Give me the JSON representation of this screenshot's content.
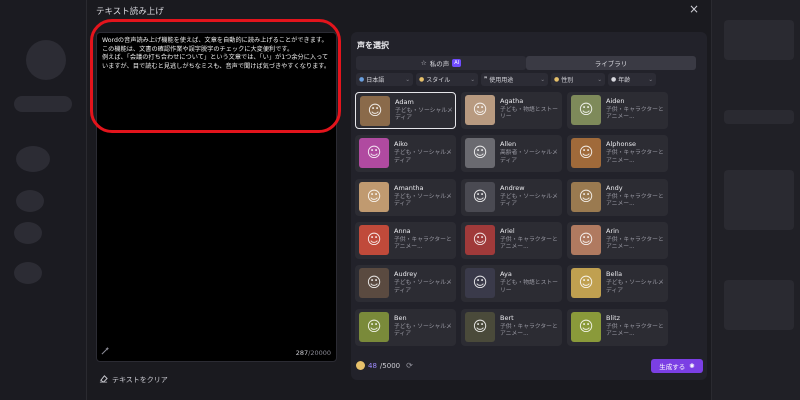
{
  "modal": {
    "title": "テキスト読み上げ",
    "close_icon": "×"
  },
  "editor": {
    "text": "Wordの音声読み上げ機能を使えば、文章を自動的に読み上げることができます。\nこの機能は、文書の確認作業や誤字脱字のチェックに大変便利です。\n例えば、「会議の打ち合わせについて」という文章では、「い」が1つ余分に入っていますが、目で読むと見逃しがちなミスも、音声で聞けば気づきやすくなります。",
    "count_current": "287",
    "count_max": "/20000",
    "clear_label": "テキストをクリア"
  },
  "voice_panel": {
    "title": "声を選択",
    "tabs": [
      {
        "label": "私の声",
        "badge": "AI"
      },
      {
        "label": "ライブラリ"
      }
    ],
    "filters": [
      {
        "icon": "globe-icon",
        "label": "日本語"
      },
      {
        "icon": "smile-icon",
        "label": "スタイル"
      },
      {
        "icon": "quote-icon",
        "label": "使用用途"
      },
      {
        "icon": "person-icon",
        "label": "性別"
      },
      {
        "icon": "age-icon",
        "label": "年齢"
      }
    ],
    "voices": [
      {
        "name": "Adam",
        "desc": "子ども・ソーシャルメディア",
        "color": "#8a6a4a",
        "selected": true
      },
      {
        "name": "Agatha",
        "desc": "子ども・物語とストーリー",
        "color": "#b89a80"
      },
      {
        "name": "Aiden",
        "desc": "子供・キャラクターとアニメー...",
        "color": "#7e8a5a"
      },
      {
        "name": "Aiko",
        "desc": "子ども・ソーシャルメディア",
        "color": "#b04aa0"
      },
      {
        "name": "Allen",
        "desc": "高齢者・ソーシャルメディア",
        "color": "#6a6a70"
      },
      {
        "name": "Alphonse",
        "desc": "子供・キャラクターとアニメー...",
        "color": "#a06a3a"
      },
      {
        "name": "Amantha",
        "desc": "子ども・ソーシャルメディア",
        "color": "#c09a70"
      },
      {
        "name": "Andrew",
        "desc": "子ども・ソーシャルメディア",
        "color": "#4a4a52"
      },
      {
        "name": "Andy",
        "desc": "子供・キャラクターとアニメー...",
        "color": "#9a7a50"
      },
      {
        "name": "Anna",
        "desc": "子供・キャラクターとアニメー...",
        "color": "#c04a3a"
      },
      {
        "name": "Ariel",
        "desc": "子供・キャラクターとアニメー...",
        "color": "#a03a3a"
      },
      {
        "name": "Arin",
        "desc": "子供・キャラクターとアニメー...",
        "color": "#b07a60"
      },
      {
        "name": "Audrey",
        "desc": "子ども・ソーシャルメディア",
        "color": "#5a4a40"
      },
      {
        "name": "Aya",
        "desc": "子ども・物語とストーリー",
        "color": "#3a3a4a"
      },
      {
        "name": "Bella",
        "desc": "子ども・ソーシャルメディア",
        "color": "#c0a050"
      },
      {
        "name": "Ben",
        "desc": "子ども・ソーシャルメディア",
        "color": "#7a8a3a"
      },
      {
        "name": "Bert",
        "desc": "子供・キャラクターとアニメー...",
        "color": "#4a4a3a"
      },
      {
        "name": "Blitz",
        "desc": "子供・キャラクターとアニメー...",
        "color": "#8a9a3a"
      }
    ],
    "credits_used": "48",
    "credits_total": "/5000",
    "generate_label": "生成する"
  }
}
